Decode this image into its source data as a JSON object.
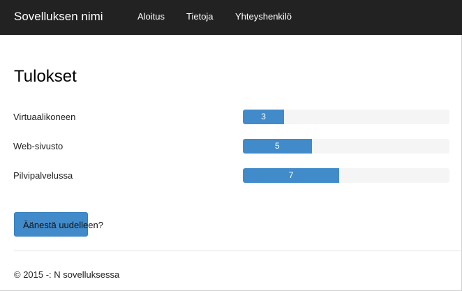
{
  "navbar": {
    "brand": "Sovelluksen nimi",
    "items": [
      "Aloitus",
      "Tietoja",
      "Yhteyshenkilö"
    ]
  },
  "main": {
    "title": "Tulokset",
    "results": [
      {
        "label": "Virtuaalikoneen",
        "value": "3",
        "fraction": 0.2
      },
      {
        "label": "Web-sivusto",
        "value": "5",
        "fraction": 0.333
      },
      {
        "label": "Pilvipalvelussa",
        "value": "7",
        "fraction": 0.467
      }
    ],
    "vote_label": "Äänestä uudelleen?"
  },
  "footer": {
    "text": "© 2015 -: N sovelluksessa"
  },
  "colors": {
    "navbar": "#222222",
    "accent": "#428bca",
    "track": "#f5f5f5"
  }
}
